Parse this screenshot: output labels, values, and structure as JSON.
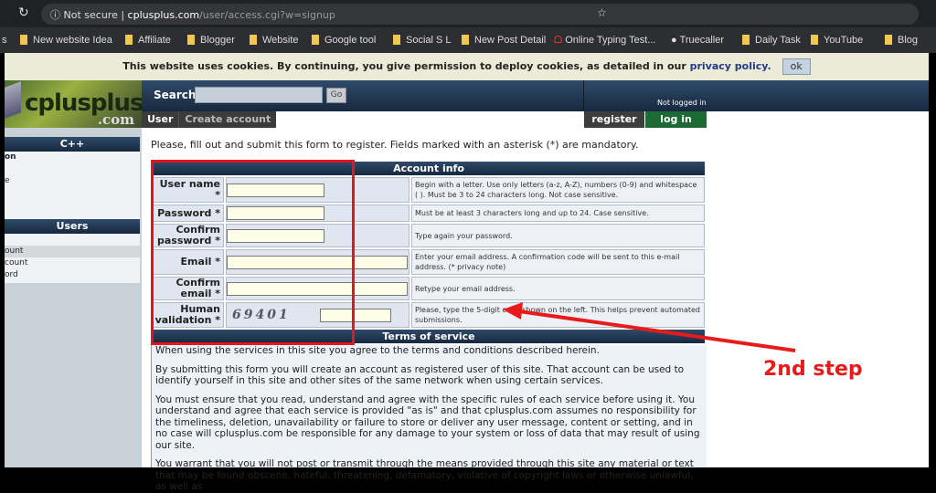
{
  "browser": {
    "url_secure": "Not secure",
    "url_host": "cplusplus.com",
    "url_path": "/user/access.cgi?w=signup",
    "bookmarks": [
      "New website Idea",
      "Affiliate",
      "Blogger",
      "Website",
      "Google tool",
      "Social S L",
      "New Post Detail",
      "Online Typing Test...",
      "Truecaller",
      "Daily Task",
      "YouTube",
      "Blog"
    ]
  },
  "cookie": {
    "text": "This website uses cookies. By continuing, you give permission to deploy cookies, as detailed in our ",
    "link": "privacy policy.",
    "ok": "ok"
  },
  "header": {
    "logo": "cplusplus",
    "logo_tld": ".com",
    "search_label": "Search:",
    "search_value": "",
    "go": "Go",
    "tabs": [
      "User",
      "Create account"
    ],
    "status": "Not logged in",
    "register": "register",
    "login": "log in"
  },
  "sidebar": {
    "cpp_title": "C++",
    "cpp_items": [
      "on",
      "",
      "e",
      ""
    ],
    "users_title": "Users",
    "users_items": [
      "",
      "ount",
      "count",
      "ord"
    ]
  },
  "intro": "Please, fill out and submit this form to register. Fields marked with an asterisk (*) are mandatory.",
  "form": {
    "header": "Account info",
    "rows": [
      {
        "label": "User name *",
        "hint": "Begin with a letter. Use only letters (a-z, A-Z), numbers (0-9) and whitespace ( ). Must be 3 to 24 characters long. Not case sensitive."
      },
      {
        "label": "Password *",
        "hint": "Must be at least 3 characters long and up to 24. Case sensitive."
      },
      {
        "label": "Confirm password *",
        "hint": "Type again your password."
      },
      {
        "label": "Email *",
        "hint": "Enter your email address. A confirmation code will be sent to this e-mail address. (* privacy note)"
      },
      {
        "label": "Confirm email *",
        "hint": "Retype your email address."
      },
      {
        "label": "Human validation *",
        "hint": "Please, type the 5-digit code shown on the left. This helps prevent automated submissions.",
        "captcha": "69401"
      }
    ],
    "tos_header": "Terms of service"
  },
  "tos": [
    "When using the services in this site you agree to the terms and conditions described herein.",
    "By submitting this form you will create an account as registered user of this site. That account can be used to identify yourself in this site and other sites of the same network when using certain services.",
    "You must ensure that you read, understand and agree with the specific rules of each service before using it. You understand and agree that each service is provided \"as is\" and that cplusplus.com assumes no responsibility for the timeliness, deletion, unavailability or failure to store or deliver any user message, content or setting, and in no case will cplusplus.com be responsible for any damage to your system or loss of data that may result of using our site.",
    "You warrant that you will not post or transmit through the means provided through this site any material or text that may be found obscene, hateful, threatening, defamatory, violative of copyright laws or otherwise unlawful, as well as"
  ],
  "annotation": {
    "text": "2nd step",
    "color": "#e81a1a"
  }
}
